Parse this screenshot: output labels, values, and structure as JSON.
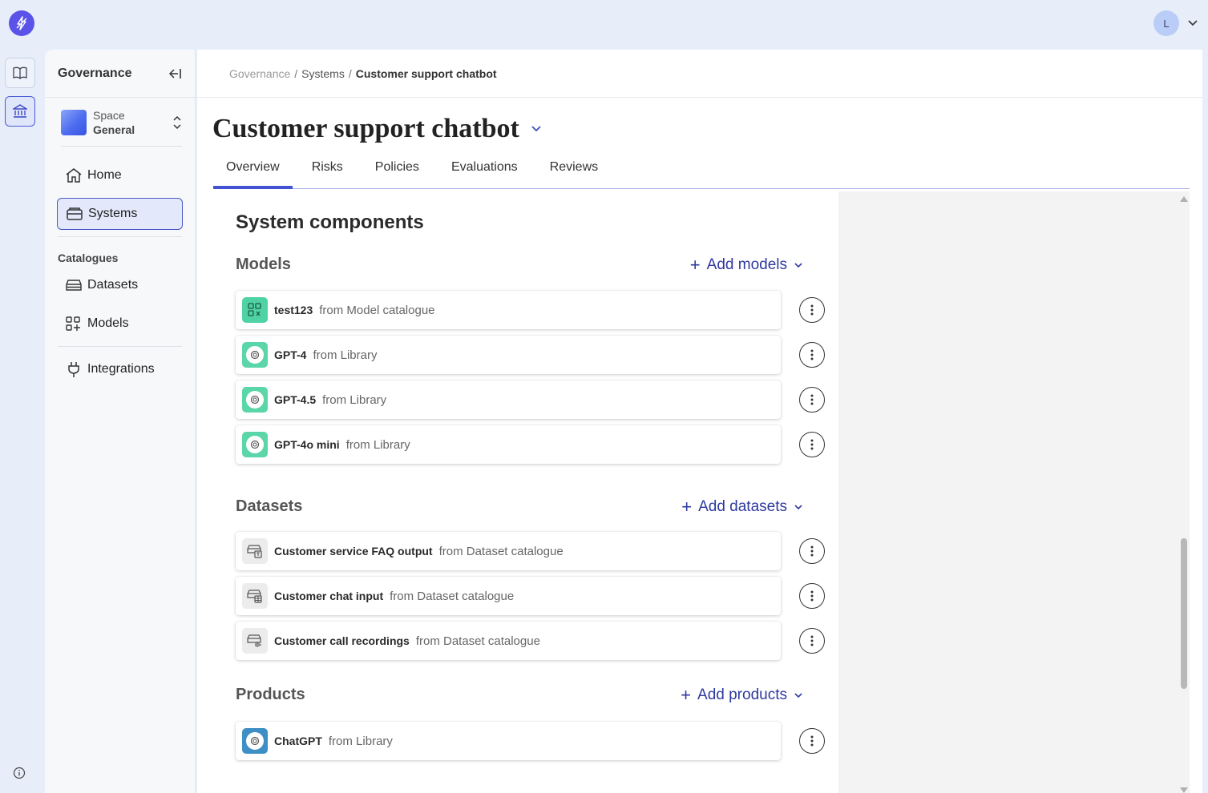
{
  "user": {
    "initial": "L"
  },
  "sidebar": {
    "title": "Governance",
    "space": {
      "label": "Space",
      "name": "General"
    },
    "nav": [
      {
        "label": "Home"
      },
      {
        "label": "Systems"
      }
    ],
    "catalogues_title": "Catalogues",
    "catalogues": [
      {
        "label": "Datasets"
      },
      {
        "label": "Models"
      }
    ],
    "integrations": "Integrations"
  },
  "breadcrumb": {
    "root": "Governance",
    "sep": "/",
    "level2": "Systems",
    "current": "Customer support chatbot"
  },
  "page": {
    "title": "Customer support chatbot",
    "tabs": [
      "Overview",
      "Risks",
      "Policies",
      "Evaluations",
      "Reviews"
    ]
  },
  "components": {
    "title": "System components",
    "models": {
      "title": "Models",
      "add_label": "Add models",
      "items": [
        {
          "name": "test123",
          "source": "from Model catalogue"
        },
        {
          "name": "GPT-4",
          "source": "from Library"
        },
        {
          "name": "GPT-4.5",
          "source": "from Library"
        },
        {
          "name": "GPT-4o mini",
          "source": "from Library"
        }
      ]
    },
    "datasets": {
      "title": "Datasets",
      "add_label": "Add datasets",
      "items": [
        {
          "name": "Customer service FAQ output",
          "source": "from Dataset catalogue"
        },
        {
          "name": "Customer chat input",
          "source": "from Dataset catalogue"
        },
        {
          "name": "Customer call recordings",
          "source": "from Dataset catalogue"
        }
      ]
    },
    "products": {
      "title": "Products",
      "add_label": "Add products",
      "items": [
        {
          "name": "ChatGPT",
          "source": "from Library"
        }
      ]
    }
  },
  "colors": {
    "accent": "#4253d3",
    "link": "#2f3a9e",
    "model_icon": "#4fd3a4",
    "product_icon": "#3e8fc5"
  }
}
